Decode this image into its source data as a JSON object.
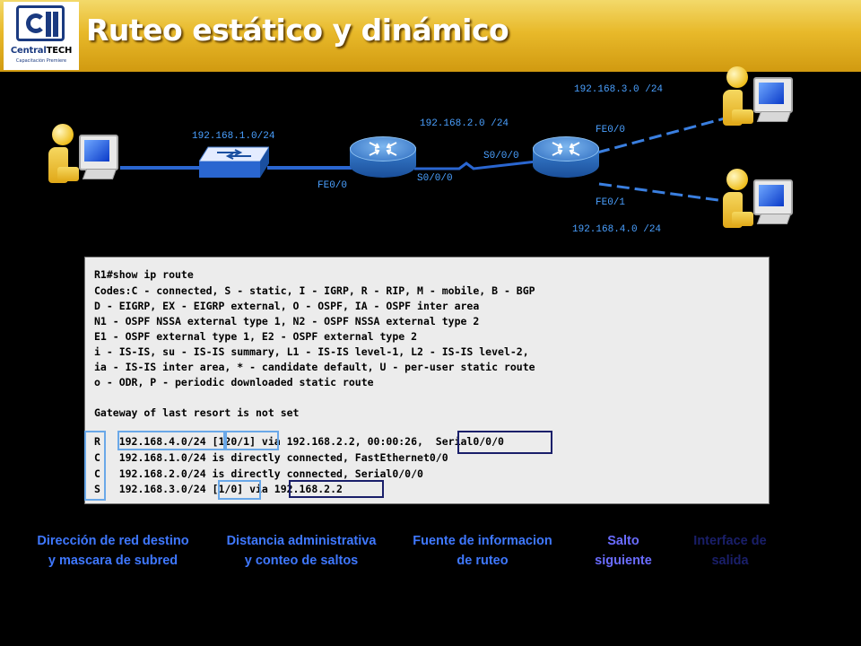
{
  "header": {
    "logo_name_a": "Central",
    "logo_name_b": "TECH",
    "logo_tag": "Capacitación Premiere",
    "title": "Ruteo estático y dinámico",
    "bg_color": "#e8b92a"
  },
  "topology": {
    "net_left": "192.168.1.0/24",
    "net_middle": "192.168.2.0 /24",
    "net_top_right": "192.168.3.0 /24",
    "net_bottom_right": "192.168.4.0 /24",
    "r1_fe": "FE0/0",
    "r1_serial": "S0/0/0",
    "r2_serial": "S0/0/0",
    "r2_fe0": "FE0/0",
    "r2_fe1": "FE0/1",
    "label_color": "#4aa0ff"
  },
  "output": {
    "lines": [
      "R1#show ip route",
      "Codes:C - connected, S - static, I - IGRP, R - RIP, M - mobile, B - BGP",
      "D - EIGRP, EX - EIGRP external, O - OSPF, IA - OSPF inter area",
      "N1 - OSPF NSSA external type 1, N2 - OSPF NSSA external type 2",
      "E1 - OSPF external type 1, E2 - OSPF external type 2",
      "i - IS-IS, su - IS-IS summary, L1 - IS-IS level-1, L2 - IS-IS level-2,",
      "ia - IS-IS inter area, * - candidate default, U - per-user static route",
      "o - ODR, P - periodic downloaded static route",
      "",
      "Gateway of last resort is not set"
    ],
    "routes": [
      "R   192.168.4.0/24 [120/1] via 192.168.2.2, 00:00:26,  Serial0/0/0",
      "C   192.168.1.0/24 is directly connected, FastEthernet0/0",
      "C   192.168.2.0/24 is directly connected, Serial0/0/0",
      "S   192.168.3.0/24 [1/0] via 192.168.2.2"
    ]
  },
  "captions": {
    "dest": [
      "Dirección de red destino",
      "y mascara de subred"
    ],
    "admin": [
      "Distancia administrativa",
      "y conteo de saltos"
    ],
    "source": [
      "Fuente de informacion",
      "de ruteo"
    ],
    "nexthop": [
      "Salto",
      "siguiente"
    ],
    "iface": [
      "Interface de",
      "salida"
    ]
  },
  "colors": {
    "cap_blue": "#3f78ff",
    "cap_purple": "#6a6cff",
    "box_light": "#6aa8e8",
    "box_dark": "#1a1f6a"
  }
}
